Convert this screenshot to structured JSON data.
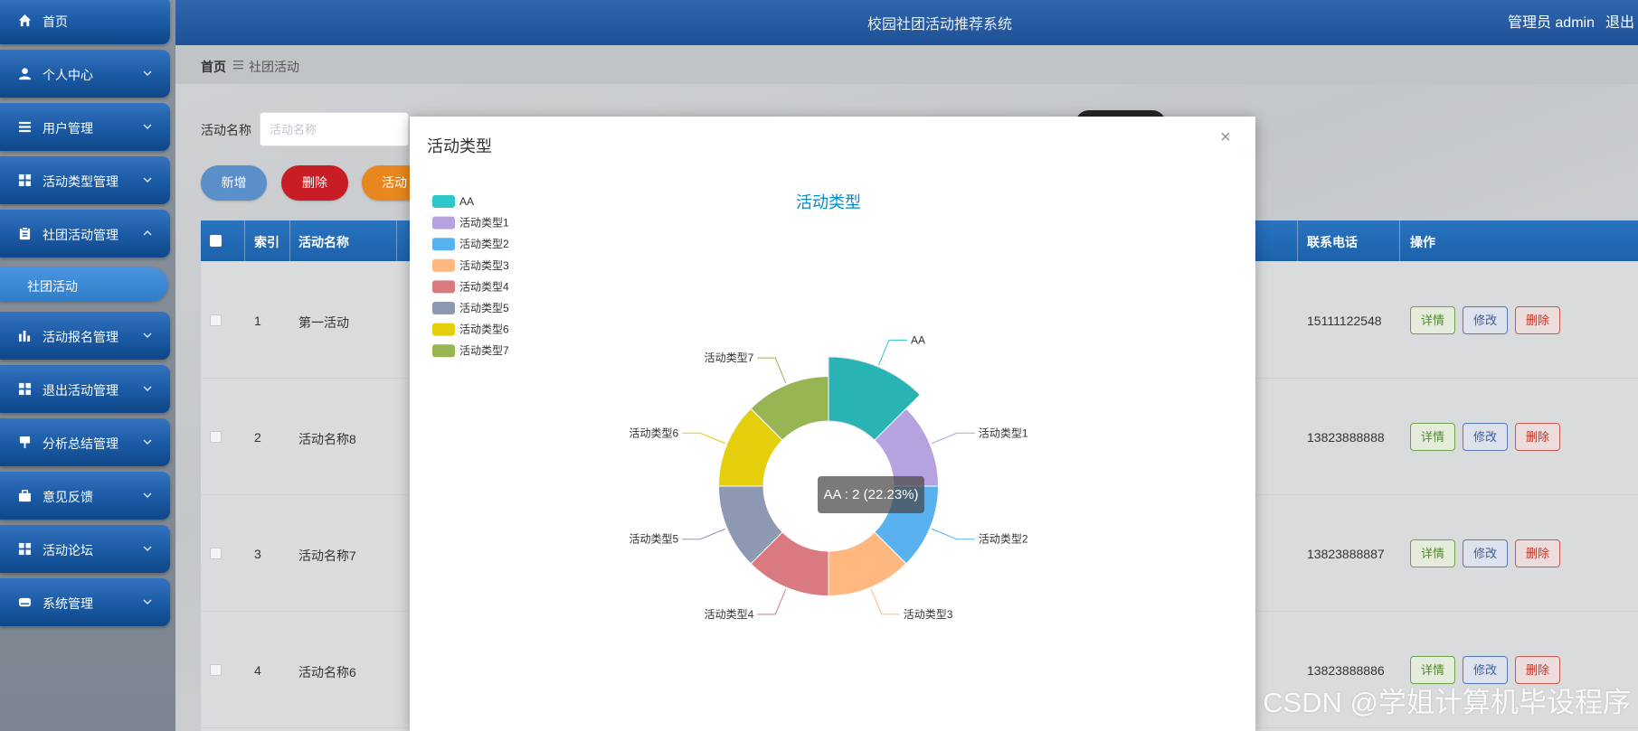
{
  "header": {
    "title": "校园社团活动推荐系统",
    "user": "管理员 admin",
    "logout": "退出"
  },
  "sidebar": {
    "items": [
      {
        "label": "首页",
        "icon": "home-icon",
        "has_children": false
      },
      {
        "label": "个人中心",
        "icon": "user-icon",
        "has_children": true
      },
      {
        "label": "用户管理",
        "icon": "menu-icon",
        "has_children": true
      },
      {
        "label": "活动类型管理",
        "icon": "grid-icon",
        "has_children": true
      },
      {
        "label": "社团活动管理",
        "icon": "clipboard-icon",
        "has_children": true,
        "expanded": true
      },
      {
        "label": "活动报名管理",
        "icon": "bar-chart-icon",
        "has_children": true
      },
      {
        "label": "退出活动管理",
        "icon": "grid-icon",
        "has_children": true
      },
      {
        "label": "分析总结管理",
        "icon": "pin-icon",
        "has_children": true
      },
      {
        "label": "意见反馈",
        "icon": "briefcase-icon",
        "has_children": true
      },
      {
        "label": "活动论坛",
        "icon": "grid-icon",
        "has_children": true
      },
      {
        "label": "系统管理",
        "icon": "drive-icon",
        "has_children": true
      }
    ],
    "active_subitem": "社团活动"
  },
  "breadcrumb": {
    "home": "首页",
    "current": "社团活动"
  },
  "search": {
    "label": "活动名称",
    "placeholder": "活动名称"
  },
  "actions": {
    "add": "新增",
    "delete": "删除",
    "export": "活动"
  },
  "table": {
    "headers": {
      "index": "索引",
      "name": "活动名称",
      "phone": "联系电话",
      "ops": "操作"
    },
    "rows": [
      {
        "index": "1",
        "name": "第一活动",
        "phone": "15111122548"
      },
      {
        "index": "2",
        "name": "活动名称8",
        "phone": "13823888888"
      },
      {
        "index": "3",
        "name": "活动名称7",
        "phone": "13823888887"
      },
      {
        "index": "4",
        "name": "活动名称6",
        "phone": "13823888886"
      }
    ],
    "ops": {
      "detail": "详情",
      "edit": "修改",
      "delete": "删除"
    }
  },
  "modal": {
    "title": "活动类型",
    "close": "×"
  },
  "tooltip": {
    "text": "AA : 2 (22.23%)"
  },
  "watermark": "CSDN @学姐计算机毕设程序",
  "colors": {
    "sidebar_item": "#1f5fa8",
    "header": "#2559a0",
    "table_header": "#2269b4",
    "add_button": "#5b8fc9",
    "delete_button": "#c81d25",
    "export_button": "#e8871e",
    "chart_title": "#008acd"
  },
  "chart_data": {
    "type": "pie",
    "style": "rose-donut",
    "title": "活动类型",
    "categories": [
      "AA",
      "活动类型1",
      "活动类型2",
      "活动类型3",
      "活动类型4",
      "活动类型5",
      "活动类型6",
      "活动类型7"
    ],
    "values": [
      2,
      1,
      1,
      1,
      1,
      1,
      1,
      1
    ],
    "colors": [
      "#2ec7c9",
      "#b6a2de",
      "#5ab1ef",
      "#ffb980",
      "#d87a80",
      "#8d98b3",
      "#e5cf0d",
      "#97b552"
    ],
    "legend": "top-left",
    "highlighted": "AA"
  }
}
